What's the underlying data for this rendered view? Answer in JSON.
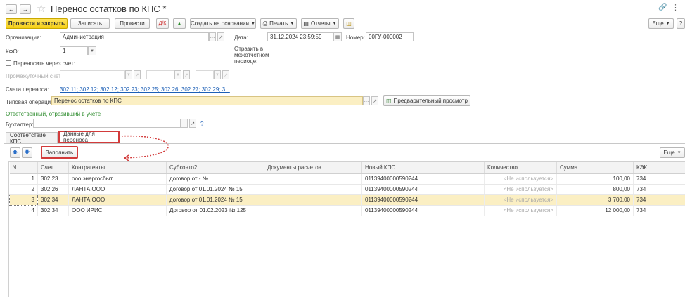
{
  "window": {
    "title": "Перенос остатков по КПС *"
  },
  "toolbar": {
    "post_close": "Провести и закрыть",
    "save": "Записать",
    "post": "Провести",
    "create_based": "Создать на основании",
    "print": "Печать",
    "reports": "Отчеты",
    "more": "Еще"
  },
  "form": {
    "org_label": "Организация:",
    "org_value": "Администрация",
    "date_label": "Дата:",
    "date_value": "31.12.2024 23:59:59",
    "number_label": "Номер:",
    "number_value": "00ГУ-000002",
    "kfo_label": "КФО:",
    "kfo_value": "1",
    "interperiod_label_1": "Отразить в",
    "interperiod_label_2": "межотчетном",
    "interperiod_label_3": "периоде:",
    "transfer_via_label": "Переносить через счет:",
    "intermediate_label": "Промежуточный счет:",
    "accounts_label": "Счета переноса:",
    "accounts_value": "302.11; 302.12; 302.12; 302.23; 302.25; 302.26; 302.27; 302.29; 3...",
    "typical_label": "Типовая операция:",
    "typical_value": "Перенос остатков по КПС",
    "preview": "Предварительный просмотр",
    "responsible": "Ответственный, отразивший в учете",
    "accountant_label": "Бухгалтер:",
    "help": "?"
  },
  "tabs": {
    "kps": "Соответствие КПС",
    "data": "Данные для переноса"
  },
  "table_toolbar": {
    "fill": "Заполнить",
    "more": "Еще"
  },
  "table": {
    "headers": [
      "N",
      "Счет",
      "Контрагенты",
      "Субконто2",
      "Документы расчетов",
      "Новый КПС",
      "Количество",
      "Сумма",
      "КЭК"
    ],
    "rows": [
      [
        "1",
        "302.23",
        "ооо энергосбыт",
        "договор от - №",
        "",
        "01139400000590244",
        "<Не используется>",
        "100,00",
        "734"
      ],
      [
        "2",
        "302.26",
        "ЛАНТА ООО",
        "договор от 01.01.2024 № 15",
        "",
        "01139400000590244",
        "<Не используется>",
        "800,00",
        "734"
      ],
      [
        "3",
        "302.34",
        "ЛАНТА ООО",
        "договор от 01.01.2024 № 15",
        "",
        "01139400000590244",
        "<Не используется>",
        "3 700,00",
        "734"
      ],
      [
        "4",
        "302.34",
        "ООО ИРИС",
        "Договор от 01.02.2023 № 125",
        "",
        "01139400000590244",
        "<Не используется>",
        "12 000,00",
        "734"
      ]
    ]
  },
  "colors": {
    "accent": "#f5cf16",
    "highlight": "#fbefc3",
    "annotation": "#d23b3b",
    "link": "#1c5fb6"
  }
}
